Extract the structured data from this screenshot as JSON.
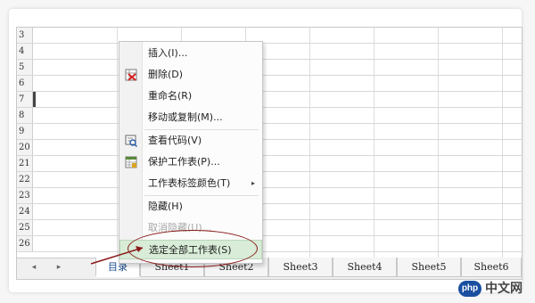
{
  "grid": {
    "row_numbers": [
      "3",
      "4",
      "5",
      "6",
      "7",
      "8",
      "9",
      "20",
      "21",
      "22",
      "23",
      "24",
      "25",
      "26"
    ]
  },
  "context_menu": {
    "items": [
      {
        "label": "插入(I)...",
        "icon": "",
        "disabled": false
      },
      {
        "label": "删除(D)",
        "icon": "delete-sheet-icon",
        "disabled": false
      },
      {
        "label": "重命名(R)",
        "icon": "",
        "disabled": false
      },
      {
        "label": "移动或复制(M)...",
        "icon": "",
        "disabled": false
      },
      {
        "label": "查看代码(V)",
        "icon": "view-code-icon",
        "disabled": false
      },
      {
        "label": "保护工作表(P)...",
        "icon": "protect-sheet-icon",
        "disabled": false
      },
      {
        "label": "工作表标签颜色(T)",
        "icon": "",
        "disabled": false,
        "submenu": true
      },
      {
        "label": "隐藏(H)",
        "icon": "",
        "disabled": false
      },
      {
        "label": "取消隐藏(U)...",
        "icon": "",
        "disabled": true
      },
      {
        "label": "选定全部工作表(S)",
        "icon": "",
        "disabled": false,
        "highlighted": true
      }
    ],
    "submenu_arrow": "▸"
  },
  "tab_nav": {
    "prev": "◂",
    "next": "▸"
  },
  "sheet_tabs": [
    {
      "label": "目录",
      "active": true
    },
    {
      "label": "Sheet1",
      "active": false
    },
    {
      "label": "Sheet2",
      "active": false
    },
    {
      "label": "Sheet3",
      "active": false
    },
    {
      "label": "Sheet4",
      "active": false
    },
    {
      "label": "Sheet5",
      "active": false
    },
    {
      "label": "Sheet6",
      "active": false
    }
  ],
  "watermark": {
    "logo": "php",
    "text": "中文网"
  },
  "colors": {
    "highlight": "#d8ecd8",
    "annotation": "#8a1a1a",
    "active_tab_text": "#1a4b8c"
  }
}
